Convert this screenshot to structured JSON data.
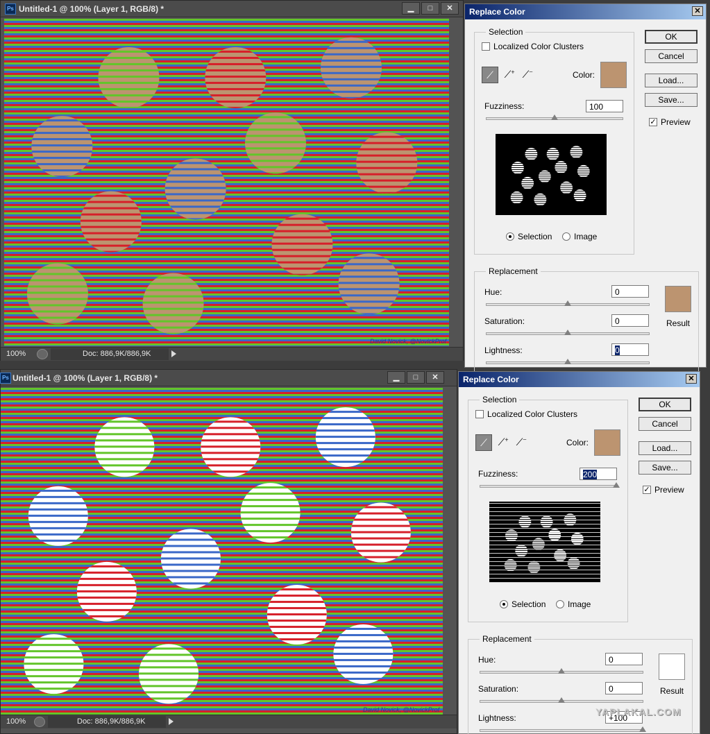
{
  "top": {
    "window": {
      "title": "Untitled-1 @ 100% (Layer 1, RGB/8) *",
      "app_logo": "Ps",
      "min_label": "▁",
      "max_label": "□",
      "close_label": "✕",
      "zoom": "100%",
      "doc_info": "Doc: 886,9K/886,9K",
      "credit": "David Novick, @NovickProf"
    },
    "dialog": {
      "title": "Replace Color",
      "close_label": "✕",
      "selection_label": "Selection",
      "localized_label": "Localized Color Clusters",
      "localized_checked": false,
      "color_label": "Color:",
      "color_hex": "#bc9470",
      "fuzziness_label": "Fuzziness:",
      "fuzziness_value": "100",
      "radio_selection": "Selection",
      "radio_image": "Image",
      "replacement_label": "Replacement",
      "hue_label": "Hue:",
      "hue_value": "0",
      "saturation_label": "Saturation:",
      "saturation_value": "0",
      "lightness_label": "Lightness:",
      "lightness_value": "0",
      "result_label": "Result",
      "result_hex": "#bc9470",
      "ok": "OK",
      "cancel": "Cancel",
      "load": "Load...",
      "save": "Save...",
      "preview_label": "Preview",
      "preview_checked": true,
      "check_mark": "✓"
    }
  },
  "bottom": {
    "window": {
      "title": "Untitled-1 @ 100% (Layer 1, RGB/8) *",
      "app_logo": "Ps",
      "min_label": "▁",
      "max_label": "□",
      "close_label": "✕",
      "zoom": "100%",
      "doc_info": "Doc: 886,9K/886,9K",
      "credit": "David Novick, @NovickProf"
    },
    "dialog": {
      "title": "Replace Color",
      "close_label": "✕",
      "selection_label": "Selection",
      "localized_label": "Localized Color Clusters",
      "localized_checked": false,
      "color_label": "Color:",
      "color_hex": "#bc9470",
      "fuzziness_label": "Fuzziness:",
      "fuzziness_value": "200",
      "radio_selection": "Selection",
      "radio_image": "Image",
      "replacement_label": "Replacement",
      "hue_label": "Hue:",
      "hue_value": "0",
      "saturation_label": "Saturation:",
      "saturation_value": "0",
      "lightness_label": "Lightness:",
      "lightness_value": "+100",
      "result_label": "Result",
      "result_hex": "#ffffff",
      "ok": "OK",
      "cancel": "Cancel",
      "load": "Load...",
      "save": "Save...",
      "preview_label": "Preview",
      "preview_checked": true,
      "check_mark": "✓"
    }
  },
  "watermark": "YAPLAKAL.COM",
  "colors": {
    "stripe_red": "#d6202a",
    "stripe_green": "#63c52a",
    "stripe_blue": "#3a68c8",
    "sphere_tint": "#bc9470"
  },
  "icons": {
    "eyedropper": "eyedropper-icon",
    "eyedropper_plus": "eyedropper-plus-icon",
    "eyedropper_minus": "eyedropper-minus-icon"
  }
}
